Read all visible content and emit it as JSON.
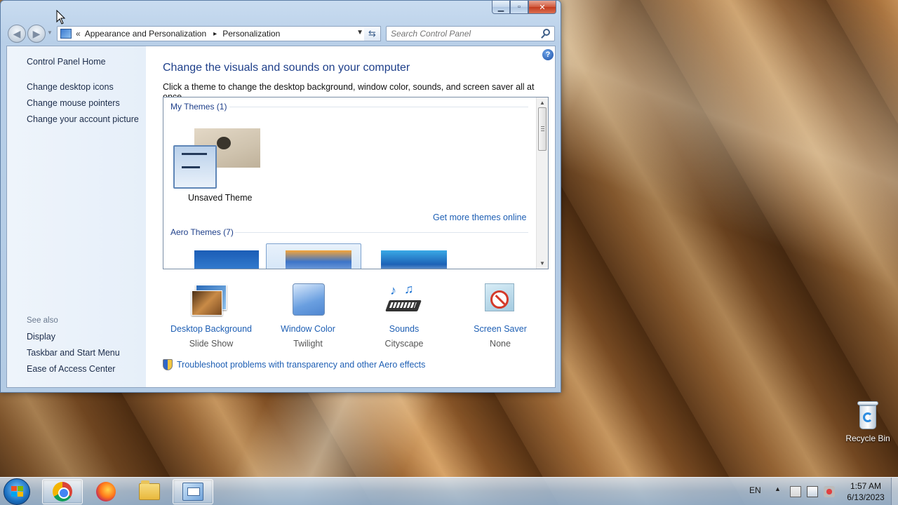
{
  "window": {
    "address": {
      "crumbs": [
        "Appearance and Personalization",
        "Personalization"
      ],
      "chevron": "«"
    },
    "search": {
      "placeholder": "Search Control Panel"
    },
    "left_pane": {
      "home": "Control Panel Home",
      "links": [
        "Change desktop icons",
        "Change mouse pointers",
        "Change your account picture"
      ],
      "see_also_label": "See also",
      "see_also": [
        "Display",
        "Taskbar and Start Menu",
        "Ease of Access Center"
      ]
    },
    "main": {
      "title": "Change the visuals and sounds on your computer",
      "description": "Click a theme to change the desktop background, window color, sounds, and screen saver all at once.",
      "my_themes_label": "My Themes (1)",
      "unsaved_theme": "Unsaved Theme",
      "get_more": "Get more themes online",
      "aero_themes_label": "Aero Themes (7)",
      "bottom": [
        {
          "link": "Desktop Background",
          "sub": "Slide Show",
          "icon": "desktop-background-icon"
        },
        {
          "link": "Window Color",
          "sub": "Twilight",
          "icon": "window-color-icon"
        },
        {
          "link": "Sounds",
          "sub": "Cityscape",
          "icon": "sounds-icon"
        },
        {
          "link": "Screen Saver",
          "sub": "None",
          "icon": "screen-saver-icon"
        }
      ],
      "troubleshoot": "Troubleshoot problems with transparency and other Aero effects"
    }
  },
  "desktop": {
    "recycle_bin": "Recycle Bin"
  },
  "taskbar": {
    "language": "EN",
    "time": "1:57 AM",
    "date": "6/13/2023",
    "apps": [
      "chrome-icon",
      "firefox-icon",
      "file-explorer-icon",
      "control-panel-icon"
    ]
  }
}
